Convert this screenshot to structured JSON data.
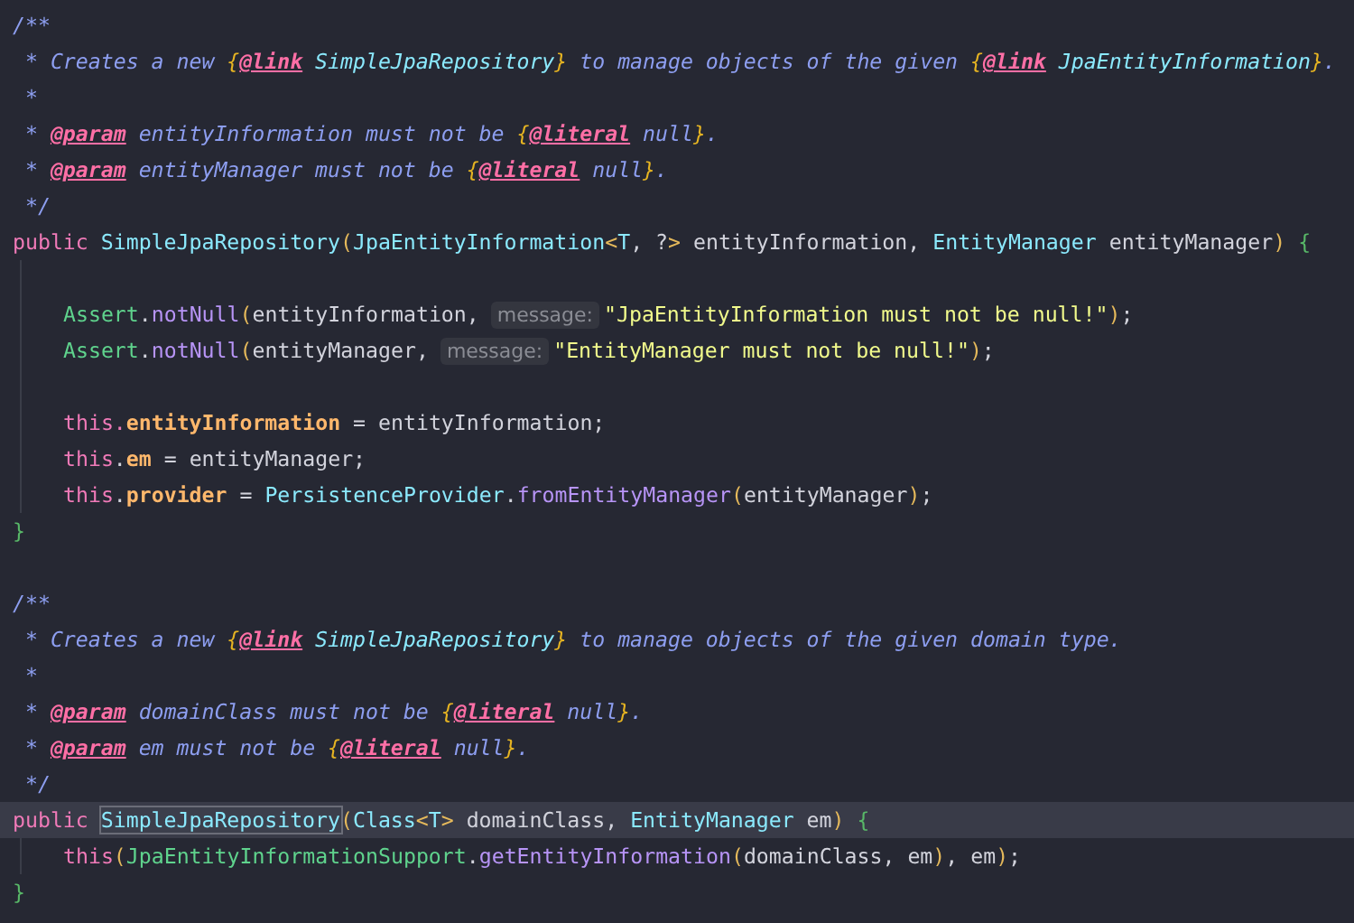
{
  "editor": {
    "lines": [
      {
        "current": false,
        "tokens": [
          {
            "text": "/**",
            "kind": "comment"
          }
        ]
      },
      {
        "current": false,
        "tokens": [
          {
            "text": " * Creates a new ",
            "kind": "comment"
          },
          {
            "text": "{",
            "kind": "doc-brace"
          },
          {
            "text": "@link",
            "kind": "doc-tag"
          },
          {
            "text": " SimpleJpaRepository",
            "kind": "doc-ref"
          },
          {
            "text": "}",
            "kind": "doc-brace"
          },
          {
            "text": " to manage objects of the given ",
            "kind": "comment"
          },
          {
            "text": "{",
            "kind": "doc-brace"
          },
          {
            "text": "@link",
            "kind": "doc-tag"
          },
          {
            "text": " JpaEntityInformation",
            "kind": "doc-ref"
          },
          {
            "text": "}",
            "kind": "doc-brace"
          },
          {
            "text": ".",
            "kind": "comment"
          }
        ]
      },
      {
        "current": false,
        "tokens": [
          {
            "text": " *",
            "kind": "comment"
          }
        ]
      },
      {
        "current": false,
        "tokens": [
          {
            "text": " * ",
            "kind": "comment"
          },
          {
            "text": "@param",
            "kind": "doc-tag"
          },
          {
            "text": " entityInformation must not be ",
            "kind": "comment"
          },
          {
            "text": "{",
            "kind": "doc-brace"
          },
          {
            "text": "@literal",
            "kind": "doc-tag"
          },
          {
            "text": " null",
            "kind": "comment"
          },
          {
            "text": "}",
            "kind": "doc-brace"
          },
          {
            "text": ".",
            "kind": "comment"
          }
        ]
      },
      {
        "current": false,
        "tokens": [
          {
            "text": " * ",
            "kind": "comment"
          },
          {
            "text": "@param",
            "kind": "doc-tag"
          },
          {
            "text": " entityManager must not be ",
            "kind": "comment"
          },
          {
            "text": "{",
            "kind": "doc-brace"
          },
          {
            "text": "@literal",
            "kind": "doc-tag"
          },
          {
            "text": " null",
            "kind": "comment"
          },
          {
            "text": "}",
            "kind": "doc-brace"
          },
          {
            "text": ".",
            "kind": "comment"
          }
        ]
      },
      {
        "current": false,
        "tokens": [
          {
            "text": " */",
            "kind": "comment"
          }
        ]
      },
      {
        "current": false,
        "tokens": [
          {
            "text": "public ",
            "kind": "keyword"
          },
          {
            "text": "SimpleJpaRepository",
            "kind": "type"
          },
          {
            "text": "(",
            "kind": "paren"
          },
          {
            "text": "JpaEntityInformation",
            "kind": "type"
          },
          {
            "text": "<",
            "kind": "paren"
          },
          {
            "text": "T",
            "kind": "type"
          },
          {
            "text": ", ?",
            "kind": "plain"
          },
          {
            "text": ">",
            "kind": "paren"
          },
          {
            "text": " entityInformation, ",
            "kind": "plain"
          },
          {
            "text": "EntityManager",
            "kind": "type"
          },
          {
            "text": " entityManager",
            "kind": "plain"
          },
          {
            "text": ") ",
            "kind": "paren"
          },
          {
            "text": "{",
            "kind": "block-brace"
          }
        ],
        "children": [
          {
            "current": false
          },
          {
            "current": false,
            "tokens": [
              {
                "text": "Assert",
                "kind": "class"
              },
              {
                "text": ".",
                "kind": "plain"
              },
              {
                "text": "notNull",
                "kind": "method"
              },
              {
                "text": "(",
                "kind": "paren"
              },
              {
                "text": "entityInformation, ",
                "kind": "plain"
              },
              {
                "text": "message:",
                "kind": "hint"
              },
              {
                "text": "\"JpaEntityInformation must not be null!\"",
                "kind": "string"
              },
              {
                "text": ")",
                "kind": "paren"
              },
              {
                "text": ";",
                "kind": "plain"
              }
            ]
          },
          {
            "current": false,
            "tokens": [
              {
                "text": "Assert",
                "kind": "class"
              },
              {
                "text": ".",
                "kind": "plain"
              },
              {
                "text": "notNull",
                "kind": "method"
              },
              {
                "text": "(",
                "kind": "paren"
              },
              {
                "text": "entityManager, ",
                "kind": "plain"
              },
              {
                "text": "message:",
                "kind": "hint"
              },
              {
                "text": "\"EntityManager must not be null!\"",
                "kind": "string"
              },
              {
                "text": ")",
                "kind": "paren"
              },
              {
                "text": ";",
                "kind": "plain"
              }
            ]
          },
          {
            "current": false
          },
          {
            "current": false,
            "tokens": [
              {
                "text": "this.",
                "kind": "keyword"
              },
              {
                "text": "entityInformation",
                "kind": "field"
              },
              {
                "text": " = entityInformation;",
                "kind": "plain"
              }
            ]
          },
          {
            "current": false,
            "tokens": [
              {
                "text": "this",
                "kind": "keyword"
              },
              {
                "text": ".",
                "kind": "plain"
              },
              {
                "text": "em",
                "kind": "field"
              },
              {
                "text": " = entityManager;",
                "kind": "plain"
              }
            ]
          },
          {
            "current": false,
            "tokens": [
              {
                "text": "this",
                "kind": "keyword"
              },
              {
                "text": ".",
                "kind": "plain"
              },
              {
                "text": "provider",
                "kind": "field"
              },
              {
                "text": " = ",
                "kind": "plain"
              },
              {
                "text": "PersistenceProvider",
                "kind": "type"
              },
              {
                "text": ".",
                "kind": "plain"
              },
              {
                "text": "fromEntityManager",
                "kind": "method"
              },
              {
                "text": "(",
                "kind": "paren"
              },
              {
                "text": "entityManager",
                "kind": "plain"
              },
              {
                "text": ")",
                "kind": "paren"
              },
              {
                "text": ";",
                "kind": "plain"
              }
            ]
          }
        ]
      },
      {
        "current": false,
        "tokens": [
          {
            "text": "}",
            "kind": "block-brace"
          }
        ]
      },
      {
        "current": false
      },
      {
        "current": false,
        "tokens": [
          {
            "text": "/**",
            "kind": "comment"
          }
        ]
      },
      {
        "current": false,
        "tokens": [
          {
            "text": " * Creates a new ",
            "kind": "comment"
          },
          {
            "text": "{",
            "kind": "doc-brace"
          },
          {
            "text": "@link",
            "kind": "doc-tag"
          },
          {
            "text": " SimpleJpaRepository",
            "kind": "doc-ref"
          },
          {
            "text": "}",
            "kind": "doc-brace"
          },
          {
            "text": " to manage objects of the given domain type.",
            "kind": "comment"
          }
        ]
      },
      {
        "current": false,
        "tokens": [
          {
            "text": " *",
            "kind": "comment"
          }
        ]
      },
      {
        "current": false,
        "tokens": [
          {
            "text": " * ",
            "kind": "comment"
          },
          {
            "text": "@param",
            "kind": "doc-tag"
          },
          {
            "text": " domainClass must not be ",
            "kind": "comment"
          },
          {
            "text": "{",
            "kind": "doc-brace"
          },
          {
            "text": "@literal",
            "kind": "doc-tag"
          },
          {
            "text": " null",
            "kind": "comment"
          },
          {
            "text": "}",
            "kind": "doc-brace"
          },
          {
            "text": ".",
            "kind": "comment"
          }
        ]
      },
      {
        "current": false,
        "tokens": [
          {
            "text": " * ",
            "kind": "comment"
          },
          {
            "text": "@param",
            "kind": "doc-tag"
          },
          {
            "text": " em must not be ",
            "kind": "comment"
          },
          {
            "text": "{",
            "kind": "doc-brace"
          },
          {
            "text": "@literal",
            "kind": "doc-tag"
          },
          {
            "text": " null",
            "kind": "comment"
          },
          {
            "text": "}",
            "kind": "doc-brace"
          },
          {
            "text": ".",
            "kind": "comment"
          }
        ]
      },
      {
        "current": false,
        "tokens": [
          {
            "text": " */",
            "kind": "comment"
          }
        ]
      },
      {
        "current": true,
        "tokens": [
          {
            "text": "public ",
            "kind": "keyword"
          },
          {
            "text": "SimpleJpaRepository",
            "kind": "usage"
          },
          {
            "text": "(",
            "kind": "paren"
          },
          {
            "text": "Class",
            "kind": "type"
          },
          {
            "text": "<",
            "kind": "paren"
          },
          {
            "text": "T",
            "kind": "type"
          },
          {
            "text": ">",
            "kind": "paren"
          },
          {
            "text": " domainClass, ",
            "kind": "plain"
          },
          {
            "text": "EntityManager",
            "kind": "type"
          },
          {
            "text": " em",
            "kind": "plain"
          },
          {
            "text": ") ",
            "kind": "paren"
          },
          {
            "text": "{",
            "kind": "block-brace"
          }
        ],
        "children": [
          {
            "current": false,
            "tokens": [
              {
                "text": "this",
                "kind": "keyword"
              },
              {
                "text": "(",
                "kind": "paren"
              },
              {
                "text": "JpaEntityInformationSupport",
                "kind": "class"
              },
              {
                "text": ".",
                "kind": "plain"
              },
              {
                "text": "getEntityInformation",
                "kind": "method"
              },
              {
                "text": "(",
                "kind": "paren"
              },
              {
                "text": "domainClass, em",
                "kind": "plain"
              },
              {
                "text": ")",
                "kind": "paren"
              },
              {
                "text": ", em",
                "kind": "plain"
              },
              {
                "text": ")",
                "kind": "paren"
              },
              {
                "text": ";",
                "kind": "plain"
              }
            ]
          }
        ]
      },
      {
        "current": false,
        "tokens": [
          {
            "text": "}",
            "kind": "block-brace"
          }
        ]
      }
    ]
  }
}
